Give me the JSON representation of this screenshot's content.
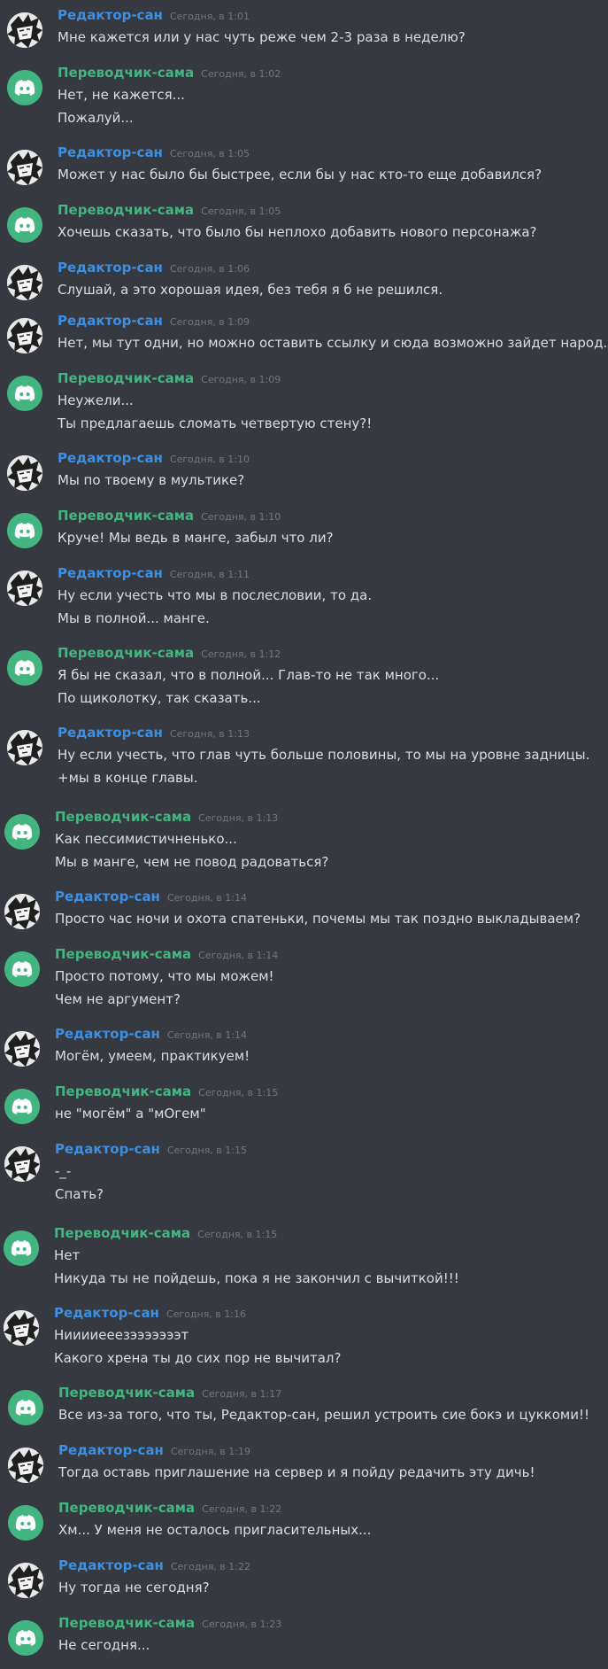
{
  "colors": {
    "background": "#36393f",
    "editor_name": "#3c8fe3",
    "translator_name": "#43b581",
    "text": "#dcddde",
    "timestamp": "#72767d"
  },
  "icons": {
    "editor_avatar": "manga-character-avatar-icon",
    "translator_avatar": "discord-logo-icon"
  },
  "messages": [
    {
      "author": "Редактор-сан",
      "role": "editor",
      "time": "Сегодня, в 1:01",
      "lines": [
        "Мне кажется или у нас чуть реже чем 2-3 раза в неделю?"
      ]
    },
    {
      "author": "Переводчик-сама",
      "role": "translator",
      "time": "Сегодня, в 1:02",
      "lines": [
        "Нет, не кажется...",
        "Пожалуй..."
      ]
    },
    {
      "author": "Редактор-сан",
      "role": "editor",
      "time": "Сегодня, в 1:05",
      "lines": [
        "Может у нас было бы быстрее, если бы у нас кто-то еще добавился?"
      ]
    },
    {
      "author": "Переводчик-сама",
      "role": "translator",
      "time": "Сегодня, в 1:05",
      "lines": [
        "Хочешь сказать, что было бы неплохо добавить нового персонажа?"
      ]
    },
    {
      "author": "Редактор-сан",
      "role": "editor",
      "time": "Сегодня, в 1:06",
      "lines": [
        "Слушай, а это хорошая идея, без тебя я б не решился."
      ]
    },
    {
      "author": "Редактор-сан",
      "role": "editor",
      "time": "Сегодня, в 1:09",
      "lines": [
        "Нет, мы тут одни, но можно оставить ссылку и сюда возможно зайдет народ."
      ]
    },
    {
      "author": "Переводчик-сама",
      "role": "translator",
      "time": "Сегодня, в 1:09",
      "lines": [
        "Неужели...",
        "Ты предлагаешь сломать четвертую стену?!"
      ]
    },
    {
      "author": "Редактор-сан",
      "role": "editor",
      "time": "Сегодня, в 1:10",
      "lines": [
        "Мы по твоему в мультике?"
      ]
    },
    {
      "author": "Переводчик-сама",
      "role": "translator",
      "time": "Сегодня, в 1:10",
      "lines": [
        "Круче! Мы ведь в манге, забыл что ли?"
      ]
    },
    {
      "author": "Редактор-сан",
      "role": "editor",
      "time": "Сегодня, в 1:11",
      "lines": [
        "Ну если учесть что мы в послесловии, то да.",
        "Мы в полной... манге."
      ]
    },
    {
      "author": "Переводчик-сама",
      "role": "translator",
      "time": "Сегодня, в 1:12",
      "lines": [
        "Я бы не сказал, что в полной... Глав-то не так много...",
        "По щиколотку, так сказать..."
      ]
    },
    {
      "author": "Редактор-сан",
      "role": "editor",
      "time": "Сегодня, в 1:13",
      "lines": [
        "Ну если учесть, что глав чуть больше половины, то мы на уровне задницы.",
        "+мы в конце главы."
      ]
    },
    {
      "author": "Переводчик-сама",
      "role": "translator",
      "time": "Сегодня, в 1:13",
      "lines": [
        "Как пессимистичненько...",
        "Мы в манге, чем не повод радоваться?"
      ]
    },
    {
      "author": "Редактор-сан",
      "role": "editor",
      "time": "Сегодня, в 1:14",
      "lines": [
        "Просто час ночи и охота спатеньки, почемы мы так поздно выкладываем?"
      ]
    },
    {
      "author": "Переводчик-сама",
      "role": "translator",
      "time": "Сегодня, в 1:14",
      "lines": [
        "Просто потому, что мы можем!",
        "Чем не аргумент?"
      ]
    },
    {
      "author": "Редактор-сан",
      "role": "editor",
      "time": "Сегодня, в 1:14",
      "lines": [
        "Могём, умеем, практикуем!"
      ]
    },
    {
      "author": "Переводчик-сама",
      "role": "translator",
      "time": "Сегодня, в 1:15",
      "lines": [
        "не \"могём\" а \"мОгем\""
      ]
    },
    {
      "author": "Редактор-сан",
      "role": "editor",
      "time": "Сегодня, в 1:15",
      "lines": [
        "-_-",
        "Спать?"
      ]
    },
    {
      "author": "Переводчик-сама",
      "role": "translator",
      "time": "Сегодня, в 1:15",
      "lines": [
        "Нет",
        "Никуда ты не пойдешь, пока я не закончил с вычиткой!!!"
      ]
    },
    {
      "author": "Редактор-сан",
      "role": "editor",
      "time": "Сегодня, в 1:16",
      "lines": [
        "Нииииееезэээээээт",
        "Какого хрена ты до сих пор не вычитал?"
      ]
    },
    {
      "author": "Переводчик-сама",
      "role": "translator",
      "time": "Сегодня, в 1:17",
      "lines": [
        "Все из-за того, что ты, Редактор-сан, решил устроить сие бокэ и цуккоми!!"
      ]
    },
    {
      "author": "Редактор-сан",
      "role": "editor",
      "time": "Сегодня, в 1:19",
      "lines": [
        "Тогда оставь приглашение на сервер и я пойду редачить эту дичь!"
      ]
    },
    {
      "author": "Переводчик-сама",
      "role": "translator",
      "time": "Сегодня, в 1:22",
      "lines": [
        "Хм... У меня не осталось пригласительных..."
      ]
    },
    {
      "author": "Редактор-сан",
      "role": "editor",
      "time": "Сегодня, в 1:22",
      "lines": [
        "Ну тогда не сегодня?"
      ]
    },
    {
      "author": "Переводчик-сама",
      "role": "translator",
      "time": "Сегодня, в 1:23",
      "lines": [
        "Не сегодня..."
      ]
    }
  ]
}
